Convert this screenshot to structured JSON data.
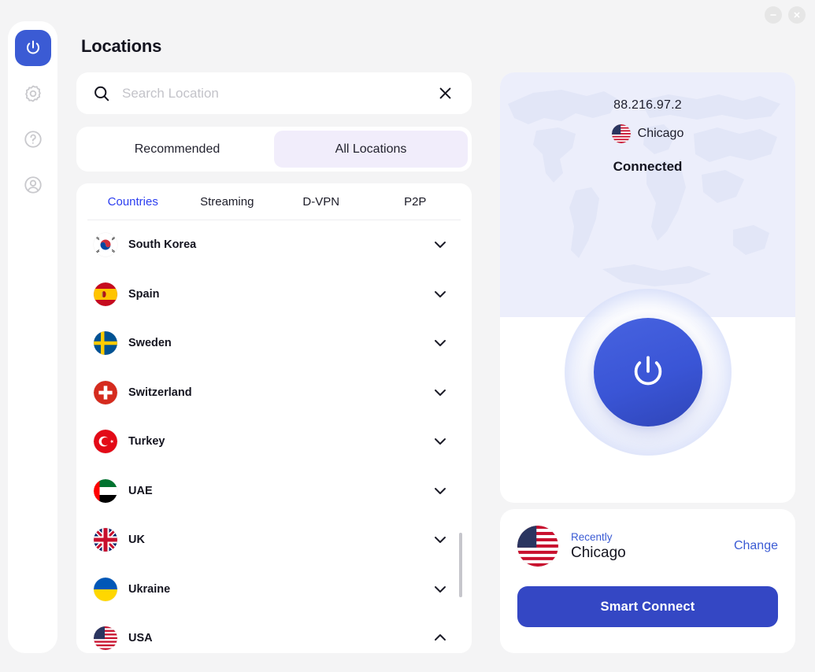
{
  "window": {
    "minimize_label": "−",
    "close_label": "×"
  },
  "sidebar": {
    "items": [
      {
        "name": "vpn-power",
        "icon": "power-icon",
        "active": true
      },
      {
        "name": "settings",
        "icon": "gear-icon",
        "active": false
      },
      {
        "name": "help",
        "icon": "help-icon",
        "active": false
      },
      {
        "name": "account",
        "icon": "user-icon",
        "active": false
      }
    ]
  },
  "header": {
    "title": "Locations"
  },
  "search": {
    "placeholder": "Search Location",
    "value": "",
    "clear_icon": "close-icon",
    "search_icon": "search-icon"
  },
  "view_toggle": {
    "options": [
      {
        "label": "Recommended",
        "active": false
      },
      {
        "label": "All Locations",
        "active": true
      }
    ],
    "active_bg": "#f1edfb"
  },
  "list": {
    "tabs": [
      {
        "label": "Countries",
        "active": true
      },
      {
        "label": "Streaming",
        "active": false
      },
      {
        "label": "D-VPN",
        "active": false
      },
      {
        "label": "P2P",
        "active": false
      }
    ],
    "active_tab_color": "#2c3ef0",
    "countries": [
      {
        "name": "South Korea",
        "flag": "kr",
        "expanded": false
      },
      {
        "name": "Spain",
        "flag": "es",
        "expanded": false
      },
      {
        "name": "Sweden",
        "flag": "se",
        "expanded": false
      },
      {
        "name": "Switzerland",
        "flag": "ch",
        "expanded": false
      },
      {
        "name": "Turkey",
        "flag": "tr",
        "expanded": false
      },
      {
        "name": "UAE",
        "flag": "ae",
        "expanded": false
      },
      {
        "name": "UK",
        "flag": "gb",
        "expanded": false
      },
      {
        "name": "Ukraine",
        "flag": "ua",
        "expanded": false
      },
      {
        "name": "USA",
        "flag": "us",
        "expanded": true
      }
    ]
  },
  "connection": {
    "ip": "88.216.97.2",
    "location": "Chicago",
    "location_flag": "us",
    "status": "Connected",
    "power_icon": "power-icon",
    "accent": "#3b5bd4",
    "map_bg": "#eceefb"
  },
  "recent": {
    "label": "Recently",
    "city": "Chicago",
    "flag": "us",
    "change_label": "Change",
    "smart_connect_label": "Smart Connect",
    "button_color": "#3447c4"
  }
}
